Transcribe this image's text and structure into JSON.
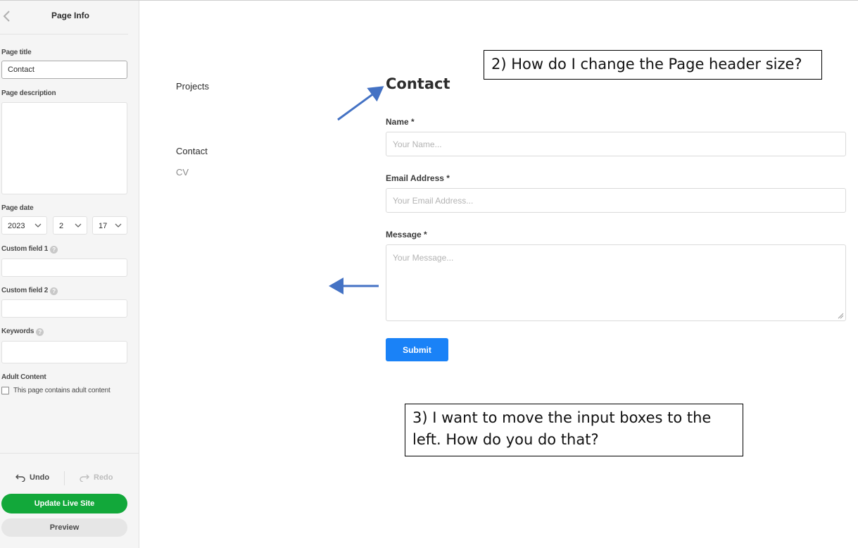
{
  "sidebar": {
    "title": "Page Info",
    "page_title_label": "Page title",
    "page_title_value": "Contact",
    "page_description_label": "Page description",
    "page_description_value": "",
    "page_date_label": "Page date",
    "page_date": {
      "year": "2023",
      "month": "2",
      "day": "17"
    },
    "custom_field_1_label": "Custom field 1",
    "custom_field_2_label": "Custom field 2",
    "keywords_label": "Keywords",
    "adult_content_label": "Adult Content",
    "adult_content_checkbox": "This page contains adult content",
    "undo_label": "Undo",
    "redo_label": "Redo",
    "update_label": "Update Live Site",
    "preview_label": "Preview"
  },
  "site_nav": {
    "items": [
      "Projects",
      "Contact",
      "CV"
    ]
  },
  "contact_form": {
    "heading": "Contact",
    "name_label": "Name *",
    "name_placeholder": "Your Name...",
    "email_label": "Email Address *",
    "email_placeholder": "Your Email Address...",
    "message_label": "Message *",
    "message_placeholder": "Your Message...",
    "submit_label": "Submit"
  },
  "annotations": {
    "callout_2": "2) How do I change the Page header size?",
    "callout_3": "3) I want to move the input boxes to the left. How do you do that?"
  },
  "colors": {
    "update_button": "#12a83a",
    "submit_button": "#1a82f7",
    "annotation_arrow": "#4472c4"
  }
}
